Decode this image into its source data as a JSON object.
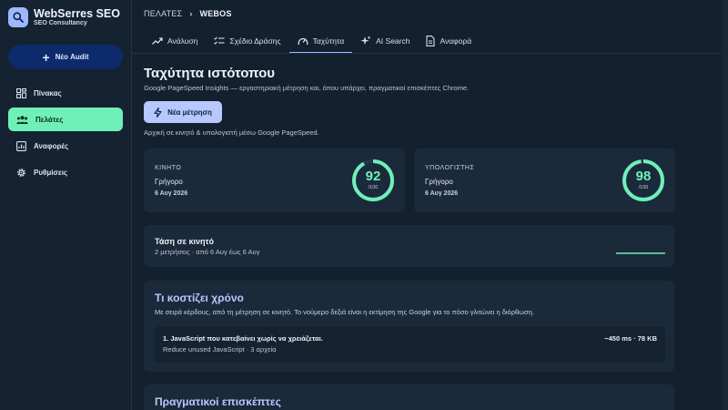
{
  "brand": {
    "name": "WebSerres SEO",
    "subtitle": "SEO Consultancy"
  },
  "sidebar": {
    "new_audit_label": "Νέο Audit",
    "items": [
      {
        "label": "Πίνακας",
        "icon": "dashboard-icon"
      },
      {
        "label": "Πελάτες",
        "icon": "users-icon",
        "active": true
      },
      {
        "label": "Αναφορές",
        "icon": "reports-icon"
      },
      {
        "label": "Ρυθμίσεις",
        "icon": "gear-icon"
      }
    ]
  },
  "breadcrumb": {
    "parent": "ΠΕΛΑΤΕΣ",
    "current": "WEBOS"
  },
  "tabs": [
    {
      "label": "Ανάλυση",
      "icon": "trend-icon"
    },
    {
      "label": "Σχέδιο Δράσης",
      "icon": "checklist-icon"
    },
    {
      "label": "Ταχύτητα",
      "icon": "speedometer-icon",
      "active": true
    },
    {
      "label": "AI Search",
      "icon": "sparkle-icon"
    },
    {
      "label": "Αναφορά",
      "icon": "document-icon"
    }
  ],
  "main": {
    "title": "Ταχύτητα ιστότοπου",
    "subtitle": "Google PageSpeed Insights — εργαστηριακή μέτρηση και, όπου υπάρχει, πραγματικοί επισκέπτες Chrome.",
    "measure_button": "Νέα μέτρηση",
    "measure_note": "Αρχική σε κινητό & υπολογιστή μέσω Google PageSpeed."
  },
  "scores": [
    {
      "label": "ΚΙΝΗΤΟ",
      "state": "Γρήγορο",
      "date": "6 Αυγ 2026",
      "score": 92,
      "denominator": "/100"
    },
    {
      "label": "ΥΠΟΛΟΓΙΣΤΗΣ",
      "state": "Γρήγορο",
      "date": "6 Αυγ 2026",
      "score": 98,
      "denominator": "/100"
    }
  ],
  "trend": {
    "title": "Τάση σε κινητό",
    "subtitle": "2 μετρήσεις · από 6 Αυγ έως 6 Αυγ"
  },
  "costs": {
    "title": "Τι κοστίζει χρόνο",
    "subtitle": "Με σειρά κέρδους, από τη μέτρηση σε κινητό. Το νούμερο δεξιά είναι η εκτίμηση της Google για το πόσο γλιτώνει η διόρθωση.",
    "items": [
      {
        "name": "1. JavaScript που κατεβαίνει χωρίς να χρειάζεται.",
        "detail": "Reduce unused JavaScript · 3 αρχεία",
        "saving": "−450 ms · 78 KB"
      }
    ]
  },
  "visitors": {
    "title": "Πραγματικοί επισκέπτες"
  },
  "colors": {
    "accent": "#9db8ff",
    "success": "#6ff0b8",
    "background": "#13202e",
    "card": "#1b2a3b"
  }
}
